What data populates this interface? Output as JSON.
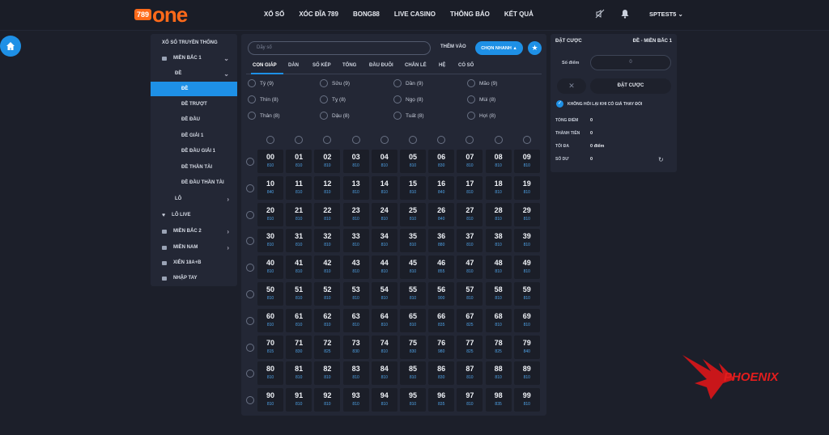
{
  "header": {
    "logo_badge": "789",
    "logo_word": "one",
    "nav": [
      "XỔ SỐ",
      "XÓC ĐĨA 789",
      "BONG88",
      "LIVE CASINO",
      "THÔNG BÁO",
      "KẾT QUẢ"
    ],
    "username": "SPTEST5"
  },
  "sidebar": {
    "items": [
      {
        "label": "XỔ SỐ TRUYỀN THỐNG"
      },
      {
        "label": "MIỀN BẮC 1"
      },
      {
        "label": "ĐỀ"
      },
      {
        "label": "ĐỀ"
      },
      {
        "label": "ĐỀ TRƯỢT"
      },
      {
        "label": "ĐỀ ĐẦU"
      },
      {
        "label": "ĐỀ GIẢI 1"
      },
      {
        "label": "ĐỀ ĐẦU GIẢI 1"
      },
      {
        "label": "ĐỀ THẦN TÀI"
      },
      {
        "label": "ĐỀ ĐẦU THẦN TÀI"
      },
      {
        "label": "LÔ"
      },
      {
        "label": "LÔ LIVE"
      },
      {
        "label": "MIỀN BẮC 2"
      },
      {
        "label": "MIỀN NAM"
      },
      {
        "label": "XIÊN 18A+B"
      },
      {
        "label": "NHẬP TAY"
      }
    ]
  },
  "main": {
    "search_placeholder": "Dãy số",
    "add_label": "THÊM VÀO",
    "quick_label": "CHỌN NHANH",
    "tabs": [
      "CON GIÁP",
      "DÀN",
      "SỐ KÉP",
      "TỔNG",
      "ĐẦU ĐUÔI",
      "CHẴN LẺ",
      "HỆ",
      "CÓ SỐ"
    ],
    "zodiac": [
      "Tý (9)",
      "Sửu (9)",
      "Dần (9)",
      "Mão (9)",
      "Thìn (8)",
      "Tỵ (8)",
      "Ngọ (8)",
      "Mùi (8)",
      "Thân (8)",
      "Dậu (8)",
      "Tuất (8)",
      "Hợi (8)"
    ],
    "grid": [
      [
        "00",
        "810"
      ],
      [
        "01",
        "810"
      ],
      [
        "02",
        "810"
      ],
      [
        "03",
        "810"
      ],
      [
        "04",
        "810"
      ],
      [
        "05",
        "810"
      ],
      [
        "06",
        "830"
      ],
      [
        "07",
        "810"
      ],
      [
        "08",
        "810"
      ],
      [
        "09",
        "810"
      ],
      [
        "10",
        "840"
      ],
      [
        "11",
        "810"
      ],
      [
        "12",
        "810"
      ],
      [
        "13",
        "810"
      ],
      [
        "14",
        "810"
      ],
      [
        "15",
        "810"
      ],
      [
        "16",
        "840"
      ],
      [
        "17",
        "810"
      ],
      [
        "18",
        "810"
      ],
      [
        "19",
        "810"
      ],
      [
        "20",
        "810"
      ],
      [
        "21",
        "810"
      ],
      [
        "22",
        "810"
      ],
      [
        "23",
        "810"
      ],
      [
        "24",
        "810"
      ],
      [
        "25",
        "810"
      ],
      [
        "26",
        "840"
      ],
      [
        "27",
        "810"
      ],
      [
        "28",
        "810"
      ],
      [
        "29",
        "810"
      ],
      [
        "30",
        "810"
      ],
      [
        "31",
        "810"
      ],
      [
        "32",
        "810"
      ],
      [
        "33",
        "810"
      ],
      [
        "34",
        "810"
      ],
      [
        "35",
        "810"
      ],
      [
        "36",
        "880"
      ],
      [
        "37",
        "810"
      ],
      [
        "38",
        "810"
      ],
      [
        "39",
        "810"
      ],
      [
        "40",
        "810"
      ],
      [
        "41",
        "810"
      ],
      [
        "42",
        "810"
      ],
      [
        "43",
        "810"
      ],
      [
        "44",
        "810"
      ],
      [
        "45",
        "810"
      ],
      [
        "46",
        "855"
      ],
      [
        "47",
        "810"
      ],
      [
        "48",
        "810"
      ],
      [
        "49",
        "810"
      ],
      [
        "50",
        "810"
      ],
      [
        "51",
        "810"
      ],
      [
        "52",
        "810"
      ],
      [
        "53",
        "810"
      ],
      [
        "54",
        "810"
      ],
      [
        "55",
        "810"
      ],
      [
        "56",
        "900"
      ],
      [
        "57",
        "810"
      ],
      [
        "58",
        "810"
      ],
      [
        "59",
        "810"
      ],
      [
        "60",
        "810"
      ],
      [
        "61",
        "810"
      ],
      [
        "62",
        "810"
      ],
      [
        "63",
        "810"
      ],
      [
        "64",
        "810"
      ],
      [
        "65",
        "810"
      ],
      [
        "66",
        "835"
      ],
      [
        "67",
        "825"
      ],
      [
        "68",
        "810"
      ],
      [
        "69",
        "810"
      ],
      [
        "70",
        "815"
      ],
      [
        "71",
        "830"
      ],
      [
        "72",
        "825"
      ],
      [
        "73",
        "830"
      ],
      [
        "74",
        "810"
      ],
      [
        "75",
        "830"
      ],
      [
        "76",
        "980"
      ],
      [
        "77",
        "825"
      ],
      [
        "78",
        "825"
      ],
      [
        "79",
        "840"
      ],
      [
        "80",
        "810"
      ],
      [
        "81",
        "810"
      ],
      [
        "82",
        "810"
      ],
      [
        "83",
        "810"
      ],
      [
        "84",
        "810"
      ],
      [
        "85",
        "810"
      ],
      [
        "86",
        "830"
      ],
      [
        "87",
        "810"
      ],
      [
        "88",
        "810"
      ],
      [
        "89",
        "810"
      ],
      [
        "90",
        "810"
      ],
      [
        "91",
        "810"
      ],
      [
        "92",
        "810"
      ],
      [
        "93",
        "810"
      ],
      [
        "94",
        "810"
      ],
      [
        "95",
        "810"
      ],
      [
        "96",
        "835"
      ],
      [
        "97",
        "810"
      ],
      [
        "98",
        "835"
      ],
      [
        "99",
        "810"
      ]
    ]
  },
  "bet_panel": {
    "title": "ĐẶT CƯỢC",
    "subtitle": "ĐỀ - MIỀN BẮC 1",
    "points_label": "Số điểm",
    "points_value": "0",
    "bet_button": "ĐẶT CƯỢC",
    "clear_symbol": "✕",
    "no_ask_label": "KHÔNG HỎI LẠI KHI CÓ GIÁ THAY ĐỔI",
    "rows": [
      {
        "k": "TỔNG ĐIỂM",
        "v": "0"
      },
      {
        "k": "THÀNH TIỀN",
        "v": "0"
      },
      {
        "k": "TỐI ĐA",
        "v": "0 điểm"
      },
      {
        "k": "SỐ DƯ",
        "v": "0"
      }
    ]
  },
  "watermark": {
    "text": "PHOENIX",
    "color": "#e21d1d"
  },
  "colors": {
    "accent": "#1e90e6",
    "brand": "#ff6a1a",
    "bg": "#1c1f2a",
    "panel": "#232735"
  }
}
